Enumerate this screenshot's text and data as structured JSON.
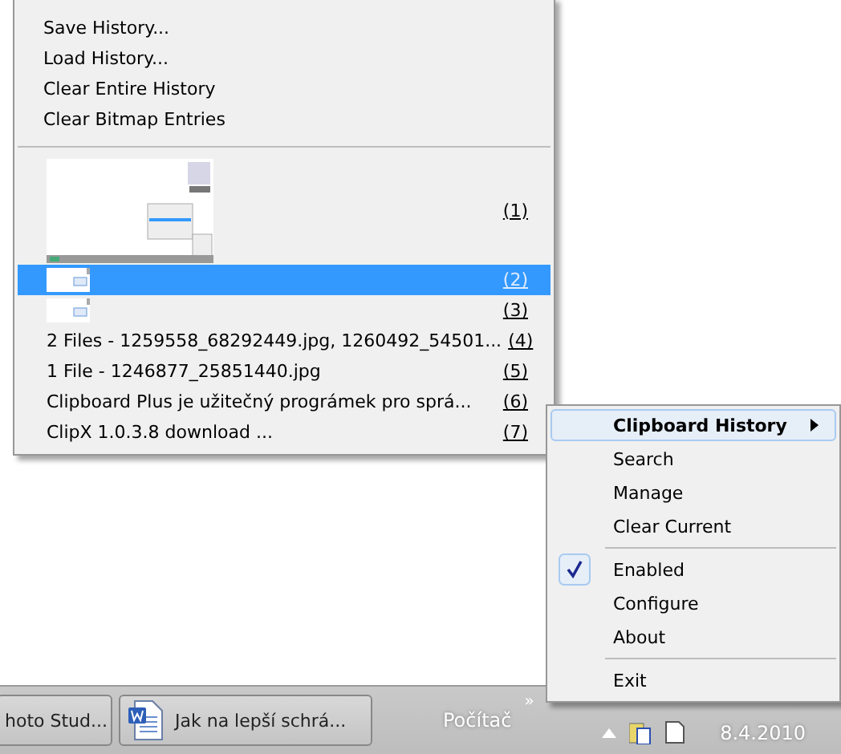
{
  "history_menu": {
    "commands": [
      "Save History...",
      "Load History...",
      "Clear Entire History",
      "Clear Bitmap Entries"
    ],
    "entries": [
      {
        "kind": "preview",
        "number": "(1)",
        "selected": false
      },
      {
        "kind": "thumbnail",
        "number": "(2)",
        "selected": true
      },
      {
        "kind": "thumbnail",
        "number": "(3)",
        "selected": false
      },
      {
        "kind": "text",
        "text": "2 Files - 1259558_68292449.jpg, 1260492_54501...",
        "number": "(4)",
        "selected": false
      },
      {
        "kind": "text",
        "text": "1 File - 1246877_25851440.jpg",
        "number": "(5)",
        "selected": false
      },
      {
        "kind": "text",
        "text": "Clipboard Plus je užitečný prográmek pro sprá...",
        "number": "(6)",
        "selected": false
      },
      {
        "kind": "text",
        "text": "ClipX 1.0.3.8 download ...",
        "number": "(7)",
        "selected": false
      }
    ]
  },
  "context_menu": {
    "items": [
      {
        "kind": "submenu",
        "label": "Clipboard History",
        "selected": true
      },
      {
        "kind": "command",
        "label": "Search"
      },
      {
        "kind": "command",
        "label": "Manage"
      },
      {
        "kind": "command",
        "label": "Clear Current"
      },
      {
        "kind": "separator"
      },
      {
        "kind": "check",
        "label": "Enabled",
        "checked": true
      },
      {
        "kind": "command",
        "label": "Configure"
      },
      {
        "kind": "command",
        "label": "About"
      },
      {
        "kind": "separator"
      },
      {
        "kind": "command",
        "label": "Exit"
      }
    ]
  },
  "taskbar": {
    "buttons": [
      {
        "label": "hoto Stud..."
      },
      {
        "label": "Jak na lepší schrá..."
      }
    ],
    "toolbar_label": "Počítač",
    "chevron": "»",
    "clock": "8.4.2010"
  }
}
